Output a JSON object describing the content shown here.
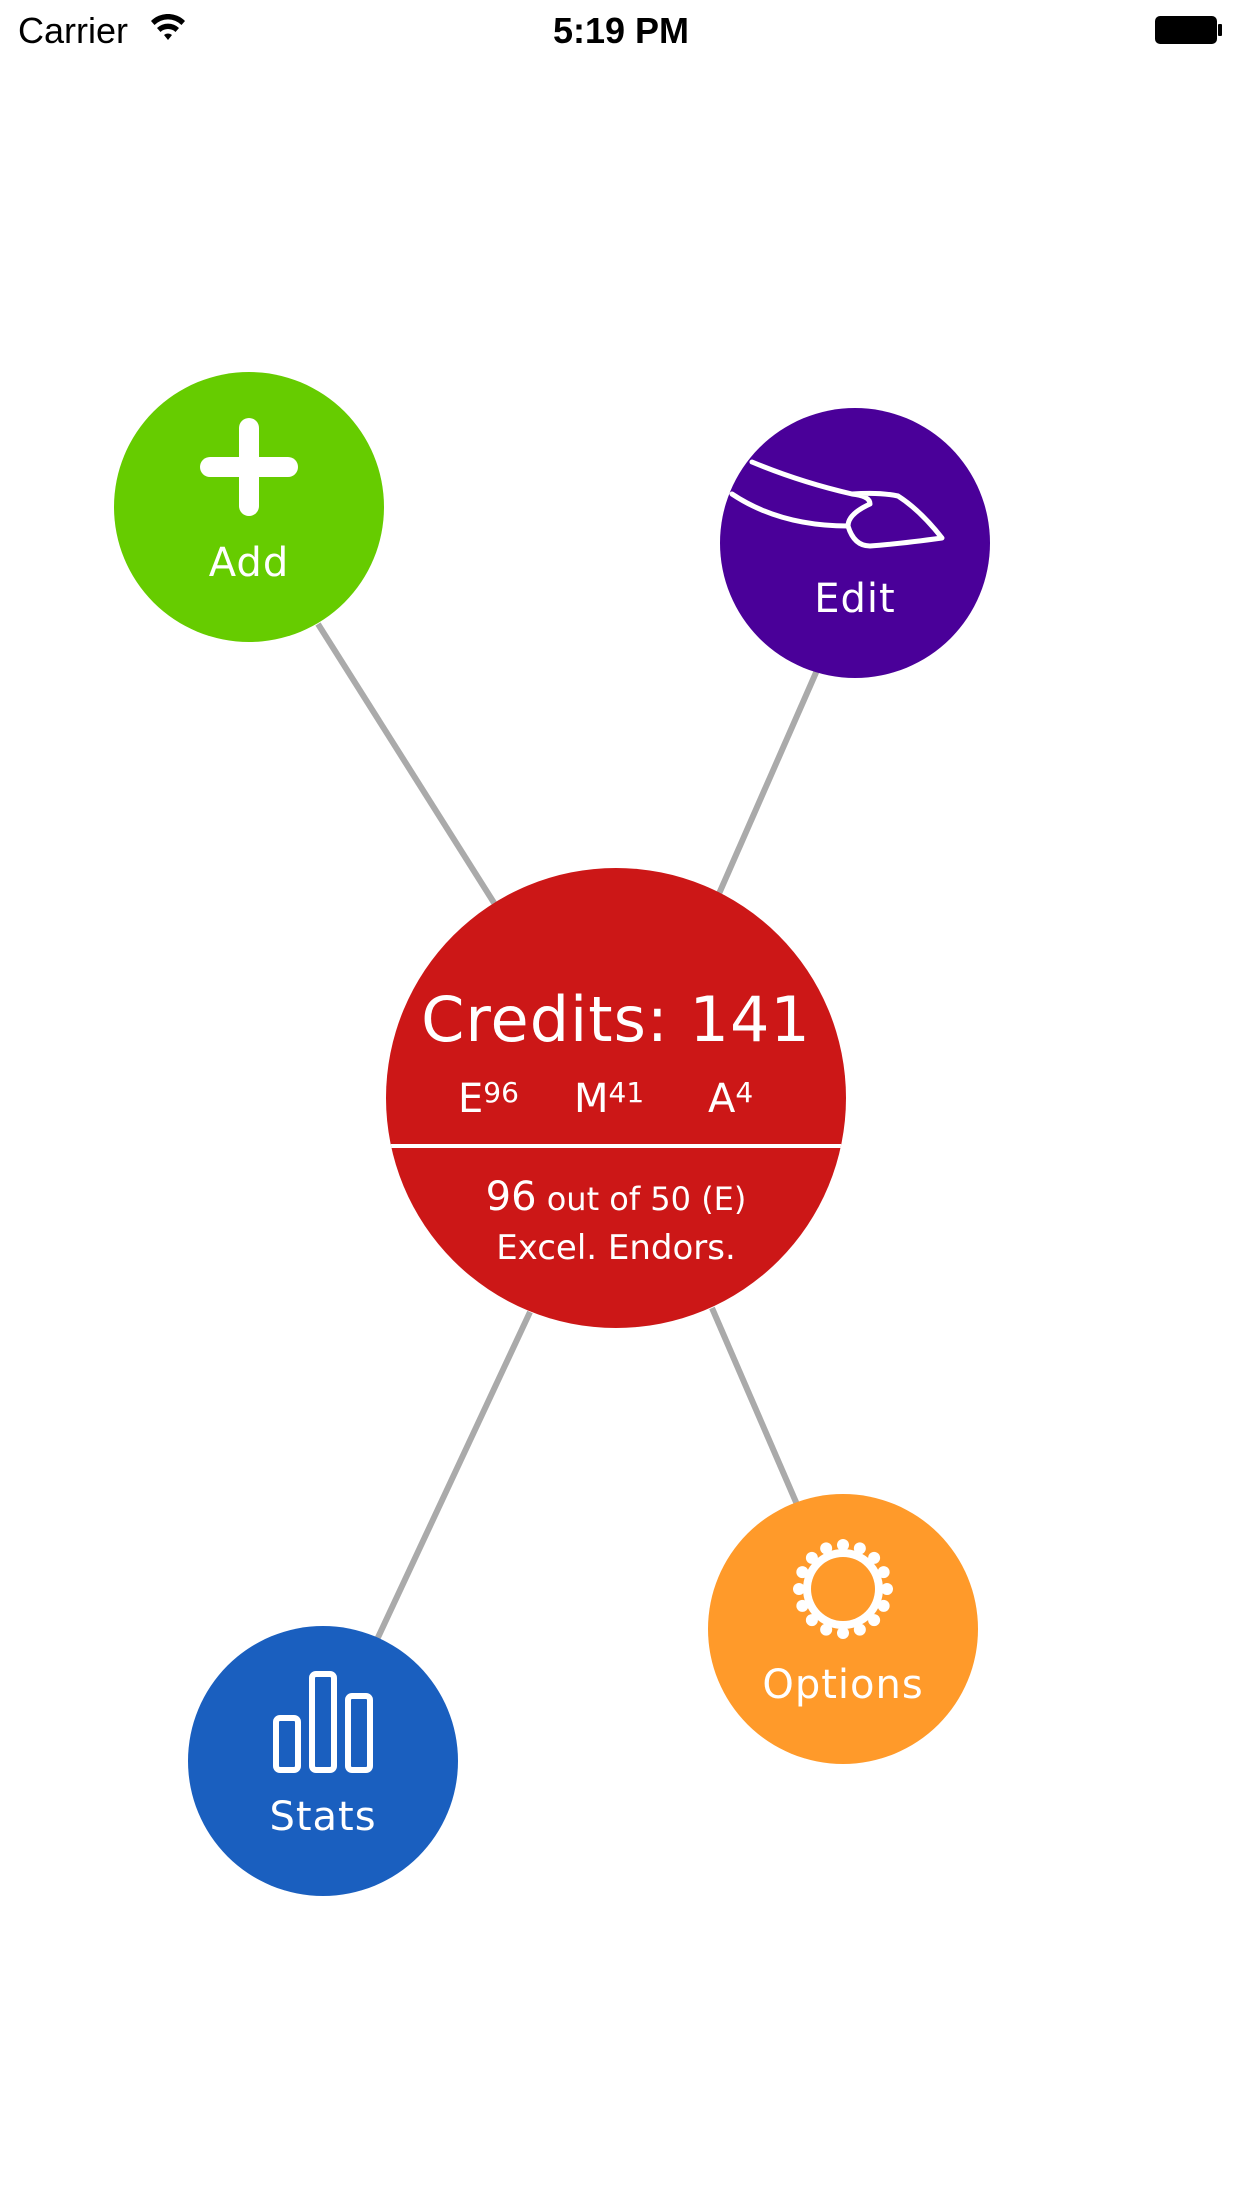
{
  "status_bar": {
    "carrier": "Carrier",
    "time": "5:19 PM",
    "wifi_icon": "wifi-icon",
    "battery_icon": "battery-icon"
  },
  "colors": {
    "add": "#66CC00",
    "edit": "#4A0099",
    "center": "#CC1717",
    "options": "#FF9A2A",
    "stats": "#1A5FBF",
    "connector": "#AAAAAA"
  },
  "nodes": {
    "add": {
      "label": "Add",
      "icon": "plus-icon"
    },
    "edit": {
      "label": "Edit",
      "icon": "finger-icon"
    },
    "options": {
      "label": "Options",
      "icon": "gear-icon"
    },
    "stats": {
      "label": "Stats",
      "icon": "bar-chart-icon"
    }
  },
  "center": {
    "credits_title": "Credits: 141",
    "e_letter": "E",
    "e_value": "96",
    "m_letter": "M",
    "m_value": "41",
    "a_letter": "A",
    "a_value": "4",
    "progress_value": "96",
    "progress_text": "out of 50 (E)",
    "status_text": "Excel. Endors."
  }
}
